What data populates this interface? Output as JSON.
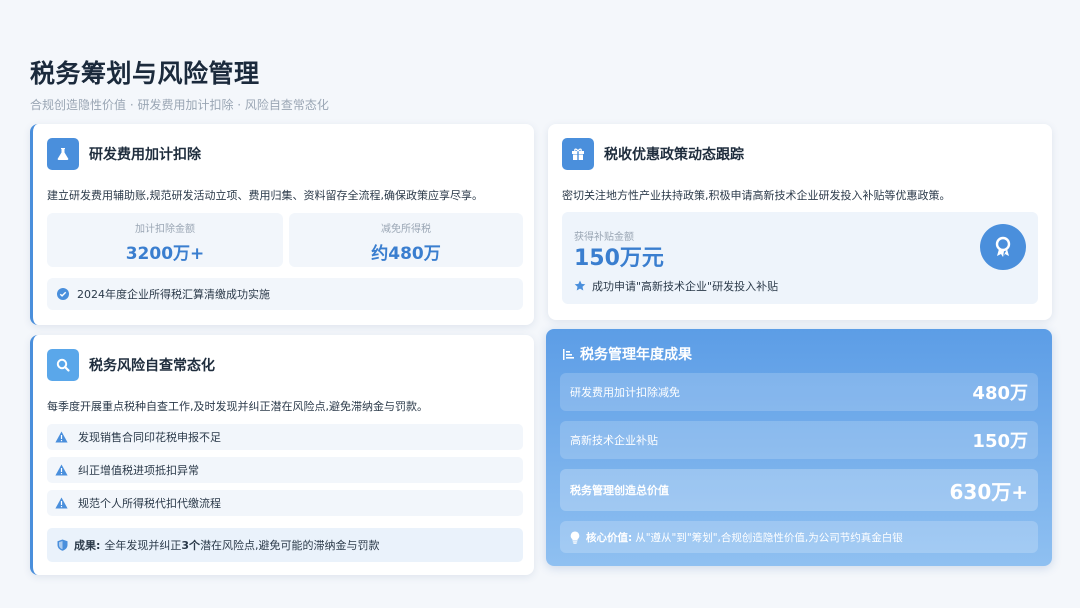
{
  "header": {
    "title": "税务筹划与风险管理",
    "subtitle": "合规创造隐性价值 · 研发费用加计扣除 · 风险自查常态化"
  },
  "rd_card": {
    "title": "研发费用加计扣除",
    "icon": "flask-icon",
    "description": "建立研发费用辅助账,规范研发活动立项、费用归集、资料留存全流程,确保政策应享尽享。",
    "stats": [
      {
        "label": "加计扣除金额",
        "value": "3200万+"
      },
      {
        "label": "减免所得税",
        "value": "约480万"
      }
    ],
    "note": "2024年度企业所得税汇算清缴成功实施"
  },
  "policy_card": {
    "title": "税收优惠政策动态跟踪",
    "icon": "gift-icon",
    "description": "密切关注地方性产业扶持政策,积极申请高新技术企业研发投入补贴等优惠政策。",
    "subsidy_label": "获得补贴金额",
    "subsidy_value": "150万元",
    "subsidy_note": "成功申请\"高新技术企业\"研发投入补贴",
    "award_icon": "award-ribbon-icon"
  },
  "risk_card": {
    "title": "税务风险自查常态化",
    "icon": "search-icon",
    "description": "每季度开展重点税种自查工作,及时发现并纠正潜在风险点,避免滞纳金与罚款。",
    "items": [
      "发现销售合同印花税申报不足",
      "纠正增值税进项抵扣异常",
      "规范个人所得税代扣代缴流程"
    ],
    "result_label": "成果:",
    "result_text_a": "全年发现并纠正",
    "result_count": "3个",
    "result_text_b": "潜在风险点,避免可能的滞纳金与罚款"
  },
  "summary_card": {
    "title": "税务管理年度成果",
    "rows": [
      {
        "label": "研发费用加计扣除减免",
        "value": "480万"
      },
      {
        "label": "高新技术企业补贴",
        "value": "150万"
      }
    ],
    "total": {
      "label": "税务管理创造总价值",
      "value": "630万+"
    },
    "core_label": "核心价值:",
    "core_text": "从\"遵从\"到\"筹划\",合规创造隐性价值,为公司节约真金白银"
  },
  "colors": {
    "accent": "#4a8fdc",
    "value_blue": "#3a7ecf",
    "background": "#f4f7fb"
  }
}
